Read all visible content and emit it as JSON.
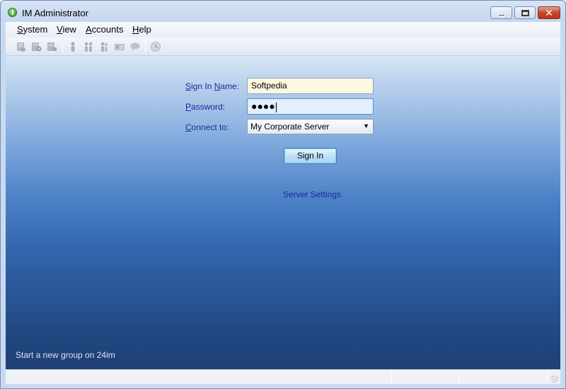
{
  "window": {
    "title": "IM Administrator"
  },
  "menu": [
    {
      "key": "S",
      "rest": "ystem"
    },
    {
      "key": "V",
      "rest": "iew"
    },
    {
      "key": "A",
      "rest": "ccounts"
    },
    {
      "key": "H",
      "rest": "elp"
    }
  ],
  "toolbar": {
    "icons": [
      "server-icon",
      "server-settings-icon",
      "server-list-icon",
      "user-icon",
      "users-icon",
      "group-icon",
      "contact-card-icon",
      "chat-icon",
      "history-icon"
    ]
  },
  "login": {
    "signin_name_label": {
      "key": "S",
      "mid": "ign In ",
      "key2": "N",
      "rest": "ame:"
    },
    "password_label": {
      "key": "P",
      "rest": "assword:"
    },
    "connect_label": {
      "key": "C",
      "rest": "onnect to:"
    },
    "signin_name_value": "Softpedia",
    "password_dots": "●●●●",
    "connect_value": "My Corporate Server",
    "signin_button": "Sign In",
    "server_settings_link": "Server Settings"
  },
  "footer": {
    "new_group_link": "Start a new group on 24im"
  },
  "colors": {
    "link": "#1a2ba0",
    "label": "#1a2a9a",
    "accent": "#3c7fb1"
  }
}
